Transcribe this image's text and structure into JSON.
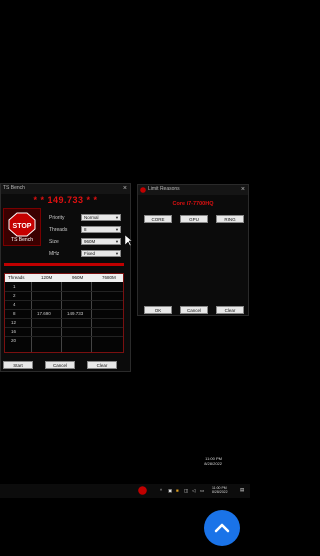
{
  "tsbench": {
    "title": "TS Bench",
    "score": "* * 149.733 * *",
    "logo_text": "TS Bench",
    "logo_sign": "STOP",
    "fields": [
      {
        "label": "Priority",
        "value": "Normal"
      },
      {
        "label": "Threads",
        "value": "8"
      },
      {
        "label": "Size",
        "value": "960M"
      },
      {
        "label": "MHz",
        "value": "Fixed"
      }
    ],
    "table": {
      "headers": [
        "Threads",
        "120M",
        "960M",
        "7680M"
      ],
      "rows": [
        {
          "threads": "1",
          "c120": "",
          "c960": "",
          "c7680": ""
        },
        {
          "threads": "2",
          "c120": "",
          "c960": "",
          "c7680": ""
        },
        {
          "threads": "4",
          "c120": "",
          "c960": "",
          "c7680": ""
        },
        {
          "threads": "8",
          "c120": "17.690",
          "c960": "149.733",
          "c7680": ""
        },
        {
          "threads": "12",
          "c120": "",
          "c960": "",
          "c7680": ""
        },
        {
          "threads": "16",
          "c120": "",
          "c960": "",
          "c7680": ""
        },
        {
          "threads": "20",
          "c120": "",
          "c960": "",
          "c7680": ""
        }
      ]
    },
    "buttons": {
      "start": "Start",
      "cancel": "Cancel",
      "clear": "Clear"
    }
  },
  "limit": {
    "title": "Limit Reasons",
    "cpu": "Core i7-7700HQ",
    "tabs": [
      "CORE",
      "GPU",
      "RING"
    ],
    "buttons": {
      "ok": "OK",
      "cancel": "Cancel",
      "clear": "Clear"
    }
  },
  "taskbar": {
    "time": "11:00 PM",
    "date": "8/28/2022"
  },
  "colors": {
    "accent_red": "#e01010",
    "fab_blue": "#1a73e8"
  },
  "fab_icon": "chevron-up-icon"
}
